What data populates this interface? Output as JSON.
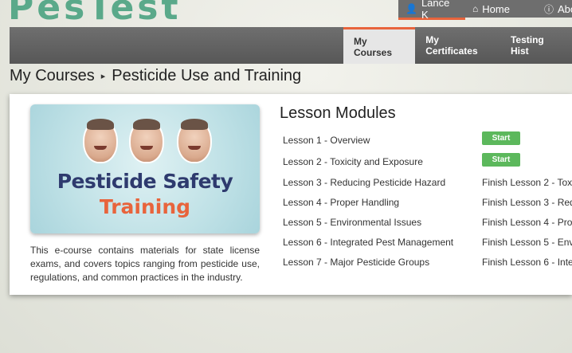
{
  "brand": {
    "logo_text": "PesTest"
  },
  "topnav": {
    "user_label": "Lance K",
    "home_label": "Home",
    "about_label": "About"
  },
  "mainnav": {
    "tabs": [
      {
        "label": "My Courses",
        "active": true
      },
      {
        "label": "My Certificates",
        "active": false
      },
      {
        "label": "Testing Hist",
        "active": false
      }
    ]
  },
  "breadcrumb": {
    "root": "My Courses",
    "separator": "▸",
    "current": "Pesticide Use and Training"
  },
  "course": {
    "image": {
      "title_line1": "Pesticide Safety",
      "title_line2": "Training"
    },
    "description": "This e-course contains materials for state license exams, and covers topics ranging from pesticide use, regulations, and common practices in the industry."
  },
  "modules": {
    "title": "Lesson Modules",
    "lessons": [
      {
        "name": "Lesson 1 - Overview",
        "status": "Start"
      },
      {
        "name": "Lesson 2 - Toxicity and Exposure",
        "status": "Start"
      },
      {
        "name": "Lesson 3 - Reducing Pesticide Hazard",
        "status": "Finish Lesson 2 - Tox"
      },
      {
        "name": "Lesson 4 - Proper Handling",
        "status": "Finish Lesson 3 - Red"
      },
      {
        "name": "Lesson 5 - Environmental Issues",
        "status": "Finish Lesson 4 - Pro"
      },
      {
        "name": "Lesson 6 - Integrated Pest Management",
        "status": "Finish Lesson 5 - Env"
      },
      {
        "name": "Lesson 7 - Major Pesticide Groups",
        "status": "Finish Lesson 6 - Inte"
      }
    ]
  },
  "colors": {
    "accent": "#e8643c",
    "brand_green": "#5aa98a",
    "start_button": "#5cb85c",
    "nav_bg": "#636363"
  }
}
